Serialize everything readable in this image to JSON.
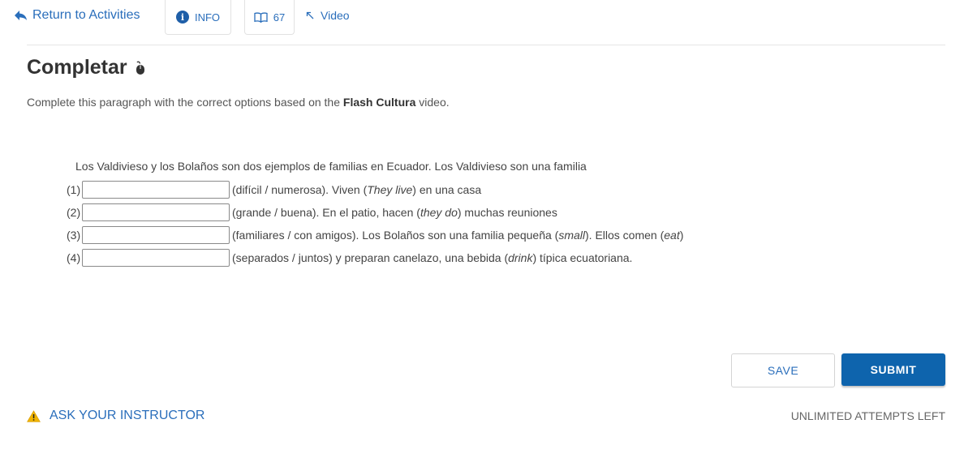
{
  "nav": {
    "return_label": "Return to Activities",
    "info_label": "INFO",
    "book_count": "67",
    "video_label": "Video"
  },
  "activity": {
    "title": "Completar",
    "instructions_before": "Complete this paragraph with the correct options based on the ",
    "instructions_bold": "Flash Cultura",
    "instructions_after": " video."
  },
  "passage": {
    "intro": "Los Valdivieso y los Bolaños son dos ejemplos de familias en Ecuador. Los Valdivieso son una familia",
    "blanks": [
      {
        "number": "(1)",
        "value": "",
        "text_a": "(difícil / numerosa). Viven (",
        "ital_a": "They live",
        "text_b": ") en una casa",
        "ital_b": "",
        "text_c": ""
      },
      {
        "number": "(2)",
        "value": "",
        "text_a": "(grande / buena). En el patio, hacen (",
        "ital_a": "they do",
        "text_b": ") muchas reuniones",
        "ital_b": "",
        "text_c": ""
      },
      {
        "number": "(3)",
        "value": "",
        "text_a": "(familiares / con amigos). Los Bolaños son una familia pequeña (",
        "ital_a": "small",
        "text_b": "). Ellos comen (",
        "ital_b": "eat",
        "text_c": ")"
      },
      {
        "number": "(4)",
        "value": "",
        "text_a": "(separados / juntos) y preparan canelazo, una bebida (",
        "ital_a": "drink",
        "text_b": ") típica ecuatoriana.",
        "ital_b": "",
        "text_c": ""
      }
    ]
  },
  "actions": {
    "save_label": "SAVE",
    "submit_label": "SUBMIT",
    "ask_label": "ASK YOUR INSTRUCTOR",
    "attempts_label": "UNLIMITED ATTEMPTS LEFT"
  },
  "colors": {
    "link": "#2a6ebb",
    "submit_bg": "#0e64ad",
    "warning": "#f0b400"
  },
  "icons": [
    "reply-arrow-icon",
    "info-icon",
    "book-icon",
    "external-arrow-icon",
    "mouse-icon",
    "warning-icon"
  ]
}
